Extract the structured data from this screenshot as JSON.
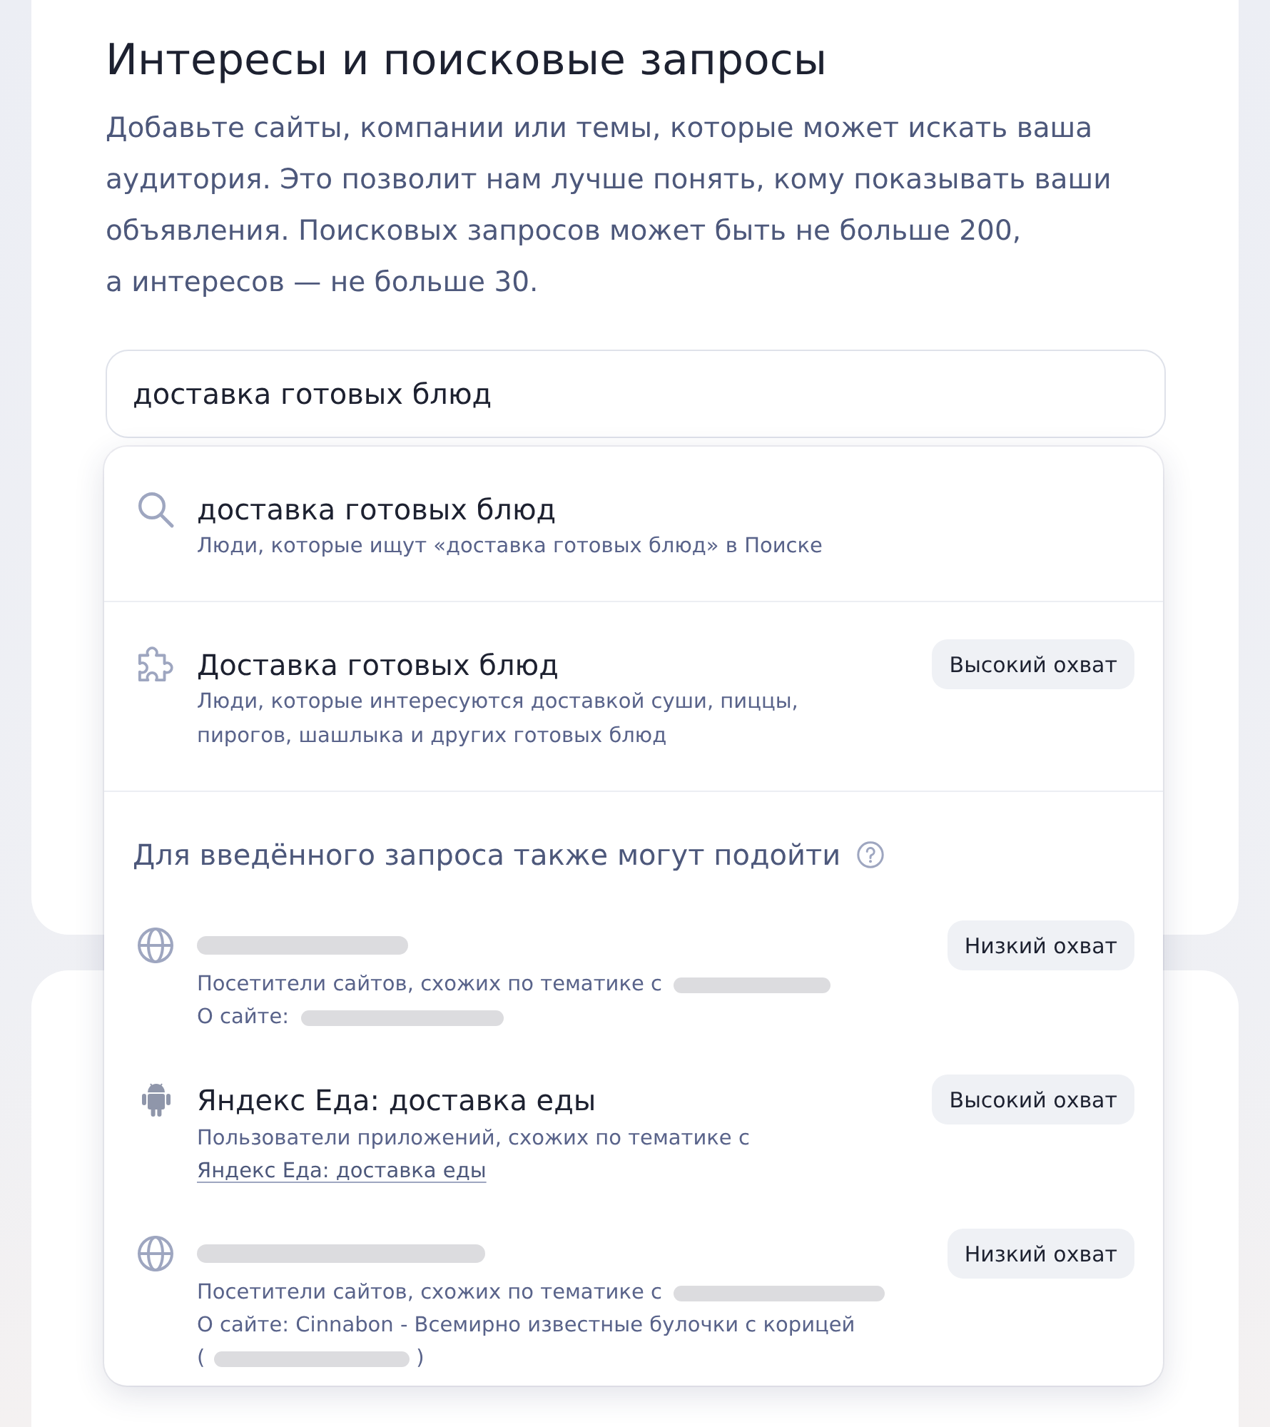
{
  "section": {
    "title": "Интересы и поисковые запросы",
    "description": "Добавьте сайты, компании или темы, которые может искать ваша аудитория. Это позволит нам лучше понять, кому показывать ваши объявления. Поисковых запросов может быть не больше 200, а интересов — не больше 30."
  },
  "search_field": {
    "value": "доставка готовых блюд"
  },
  "suggestions": [
    {
      "kind": "query",
      "title": "доставка готовых блюд",
      "description": "Люди, которые ищут «доставка готовых блюд» в Поиске"
    },
    {
      "kind": "interest",
      "title": "Доставка готовых блюд",
      "badge": "Высокий охват",
      "description": "Люди, которые интересуются доставкой суши, пиццы, пирогов, шашлыка и других готовых блюд"
    }
  ],
  "related": {
    "heading": "Для введённого запроса также могут подойти",
    "items": [
      {
        "kind": "site",
        "title_redacted": true,
        "badge": "Низкий охват",
        "similar_text": "Посетители сайтов, схожих по тематике с",
        "similar_redacted": true,
        "about": "О сайте:",
        "about_redacted": true
      },
      {
        "kind": "app",
        "title": "Яндекс Еда: доставка еды",
        "title_redacted": false,
        "badge": "Высокий охват",
        "similar_text": "Пользователи приложений, схожих по тематике с",
        "similar_link": "Яндекс Еда: доставка еды",
        "similar_redacted": false
      },
      {
        "kind": "site",
        "title_redacted": true,
        "badge": "Низкий охват",
        "similar_text": "Посетители сайтов, схожих по тематике с",
        "similar_redacted": true,
        "about": "О сайте: Cinnabon - Всемирно известные булочки с корицей",
        "about_redacted": false,
        "address_open": "(",
        "address_close": ")"
      }
    ]
  }
}
